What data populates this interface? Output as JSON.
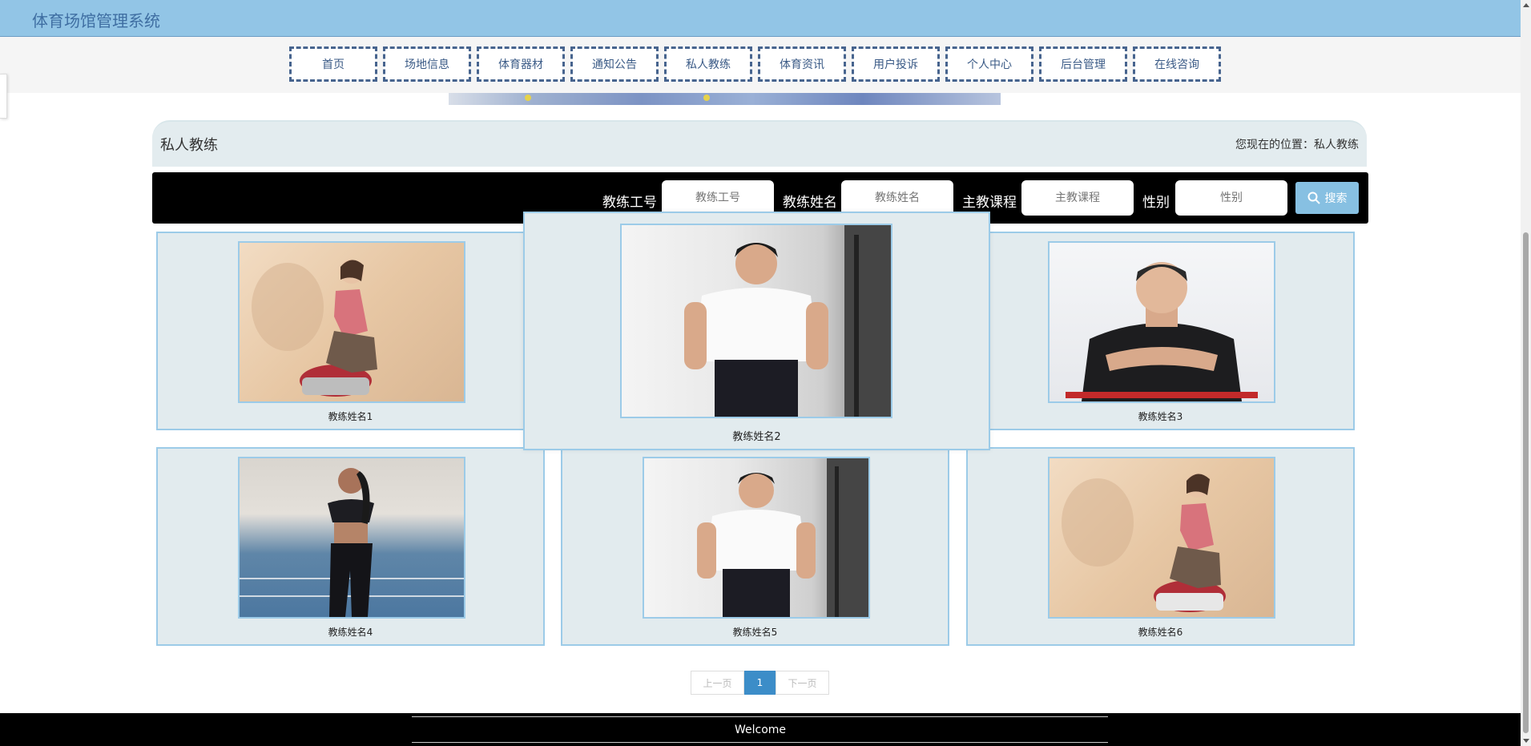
{
  "app": {
    "title": "体育场馆管理系统"
  },
  "nav": [
    {
      "label": "首页"
    },
    {
      "label": "场地信息"
    },
    {
      "label": "体育器材"
    },
    {
      "label": "通知公告"
    },
    {
      "label": "私人教练"
    },
    {
      "label": "体育资讯"
    },
    {
      "label": "用户投诉"
    },
    {
      "label": "个人中心"
    },
    {
      "label": "后台管理"
    },
    {
      "label": "在线咨询"
    }
  ],
  "page": {
    "title": "私人教练",
    "location": "您现在的位置：私人教练"
  },
  "search": {
    "fields": [
      {
        "label": "教练工号",
        "placeholder": "教练工号"
      },
      {
        "label": "教练姓名",
        "placeholder": "教练姓名"
      },
      {
        "label": "主教课程",
        "placeholder": "主教课程"
      },
      {
        "label": "性别",
        "placeholder": "性别"
      }
    ],
    "button_label": "搜索"
  },
  "coaches": [
    {
      "name": "教练姓名1"
    },
    {
      "name": "教练姓名2"
    },
    {
      "name": "教练姓名3"
    },
    {
      "name": "教练姓名4"
    },
    {
      "name": "教练姓名5"
    },
    {
      "name": "教练姓名6"
    }
  ],
  "pagination": {
    "prev": "上一页",
    "current": "1",
    "next": "下一页"
  },
  "footer": {
    "text": "Welcome"
  },
  "colors": {
    "header": "#92c5e6",
    "accent": "#3c8dc8",
    "card_border": "#9ccbe8",
    "card_bg": "#e2ebee"
  }
}
